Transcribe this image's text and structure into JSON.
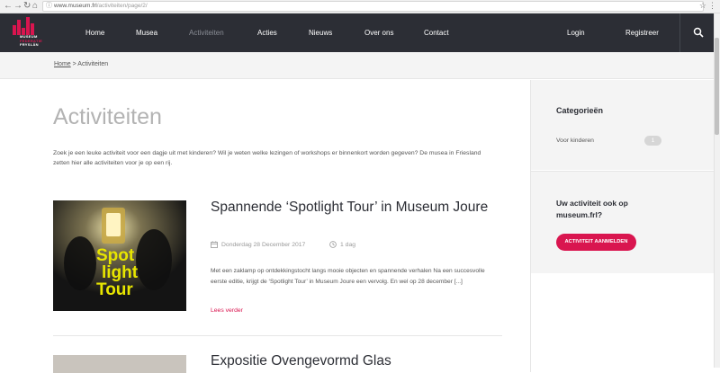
{
  "browser": {
    "url_host": "www.museum.frl",
    "url_path": "/activiteiten/page/2/",
    "back_icon": "arrow-left-icon",
    "forward_icon": "arrow-right-icon",
    "reload_icon": "reload-icon",
    "home_icon": "home-icon"
  },
  "header": {
    "logo_lines": [
      "MUSEUM",
      "FEDERATIE",
      "FRYSLÂN"
    ],
    "nav": [
      {
        "label": "Home",
        "active": false
      },
      {
        "label": "Musea",
        "active": false
      },
      {
        "label": "Activiteiten",
        "active": true
      },
      {
        "label": "Acties",
        "active": false
      },
      {
        "label": "Nieuws",
        "active": false
      },
      {
        "label": "Over ons",
        "active": false
      },
      {
        "label": "Contact",
        "active": false
      }
    ],
    "login": "Login",
    "register": "Registreer",
    "search_icon": "search-icon"
  },
  "breadcrumb": {
    "home": "Home",
    "separator": " > ",
    "current": "Activiteiten"
  },
  "main": {
    "title": "Activiteiten",
    "intro": "Zoek je een leuke activiteit voor een dagje uit met kinderen? Wil je weten welke lezingen of workshops er binnenkort worden gegeven? De musea in Friesland zetten hier alle activiteiten voor je op een rij.",
    "cards": [
      {
        "title": "Spannende ‘Spotlight Tour’ in Museum Joure",
        "date": "Donderdag 28 December 2017",
        "duration": "1 dag",
        "text": "Met een zaklamp op ontdekkingstocht langs mooie objecten en spannende verhalen Na een succesvolle eerste editie, krijgt de ‘Spotlight Tour’ in Museum Joure een vervolg. En wel op 28 december [...]",
        "read_more": "Lees verder",
        "image_text": [
          "Spot",
          "light",
          "Tour"
        ]
      },
      {
        "title": "Expositie Ovengevormd Glas"
      }
    ]
  },
  "sidebar": {
    "categories_title": "Categorieën",
    "categories": [
      {
        "label": "Voor kinderen",
        "count": "1"
      }
    ],
    "cta_title": "Uw activiteit ook op museum.frl?",
    "cta_button": "ACTIVITEIT AANMELDEN"
  },
  "colors": {
    "brand": "#d9154f",
    "header_bg": "#2c2e35"
  }
}
